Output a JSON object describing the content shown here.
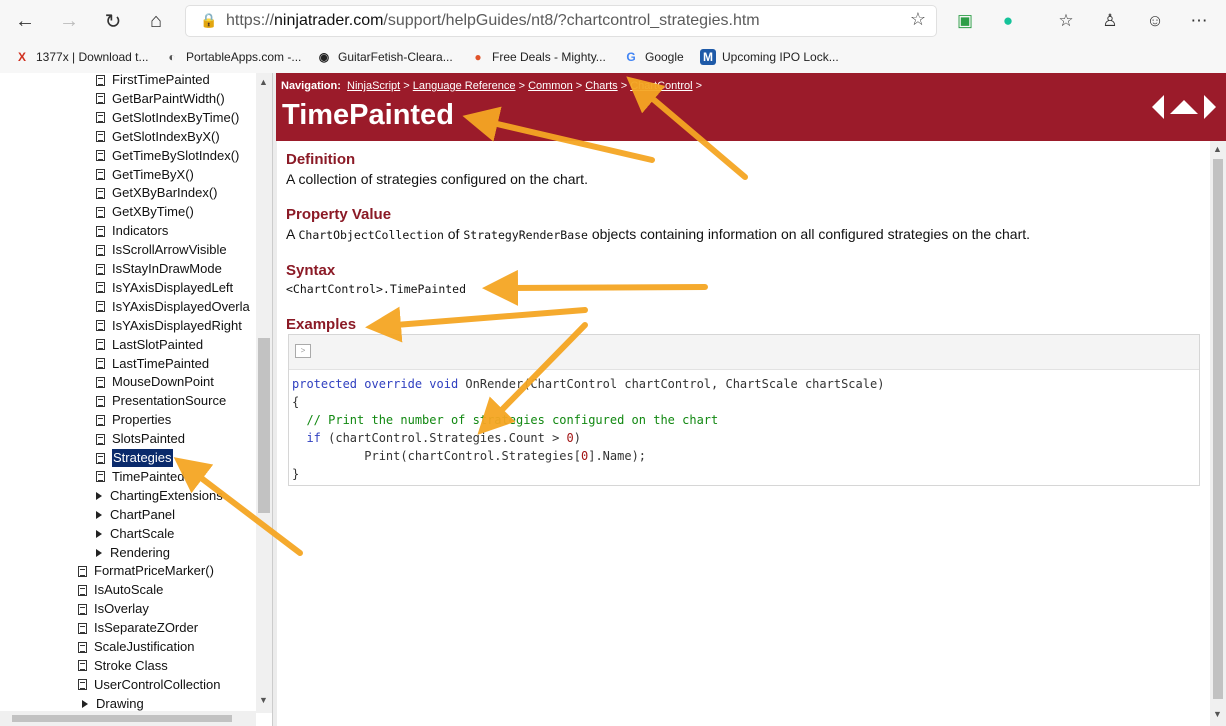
{
  "browser": {
    "url_prefix": "https://",
    "url_host": "ninjatrader.com",
    "url_path": "/support/helpGuides/nt8/?chartcontrol_strategies.htm"
  },
  "bookmarks": [
    {
      "label": "1377x | Download t...",
      "icon": "x-icon",
      "color": "#d0301f",
      "glyph": "X"
    },
    {
      "label": "PortableApps.com -...",
      "icon": "portableapps-icon",
      "color": "#555",
      "glyph": "◐"
    },
    {
      "label": "GuitarFetish-Cleara...",
      "icon": "guitarfetish-icon",
      "color": "#222",
      "glyph": "😎"
    },
    {
      "label": "Free Deals - Mighty...",
      "icon": "deals-icon",
      "color": "#e0532a",
      "glyph": "●"
    },
    {
      "label": "Google",
      "icon": "google-icon",
      "color": "#4285f4",
      "glyph": "G"
    },
    {
      "label": "Upcoming IPO Lock...",
      "icon": "ipo-icon",
      "color": "#1e5aa8",
      "glyph": "M"
    }
  ],
  "toc": [
    {
      "label": "FirstTimePainted",
      "type": "page",
      "indent": 2
    },
    {
      "label": "GetBarPaintWidth()",
      "type": "page",
      "indent": 2
    },
    {
      "label": "GetSlotIndexByTime()",
      "type": "page",
      "indent": 2
    },
    {
      "label": "GetSlotIndexByX()",
      "type": "page",
      "indent": 2
    },
    {
      "label": "GetTimeBySlotIndex()",
      "type": "page",
      "indent": 2
    },
    {
      "label": "GetTimeByX()",
      "type": "page",
      "indent": 2
    },
    {
      "label": "GetXByBarIndex()",
      "type": "page",
      "indent": 2
    },
    {
      "label": "GetXByTime()",
      "type": "page",
      "indent": 2
    },
    {
      "label": "Indicators",
      "type": "page",
      "indent": 2
    },
    {
      "label": "IsScrollArrowVisible",
      "type": "page",
      "indent": 2
    },
    {
      "label": "IsStayInDrawMode",
      "type": "page",
      "indent": 2
    },
    {
      "label": "IsYAxisDisplayedLeft",
      "type": "page",
      "indent": 2
    },
    {
      "label": "IsYAxisDisplayedOverla",
      "type": "page",
      "indent": 2
    },
    {
      "label": "IsYAxisDisplayedRight",
      "type": "page",
      "indent": 2
    },
    {
      "label": "LastSlotPainted",
      "type": "page",
      "indent": 2
    },
    {
      "label": "LastTimePainted",
      "type": "page",
      "indent": 2
    },
    {
      "label": "MouseDownPoint",
      "type": "page",
      "indent": 2
    },
    {
      "label": "PresentationSource",
      "type": "page",
      "indent": 2
    },
    {
      "label": "Properties",
      "type": "page",
      "indent": 2
    },
    {
      "label": "SlotsPainted",
      "type": "page",
      "indent": 2
    },
    {
      "label": "Strategies",
      "type": "page",
      "indent": 2,
      "selected": true
    },
    {
      "label": "TimePainted",
      "type": "page",
      "indent": 2
    },
    {
      "label": "ChartingExtensions",
      "type": "folder",
      "indent": 1
    },
    {
      "label": "ChartPanel",
      "type": "folder",
      "indent": 1
    },
    {
      "label": "ChartScale",
      "type": "folder",
      "indent": 1
    },
    {
      "label": "Rendering",
      "type": "folder",
      "indent": 1
    },
    {
      "label": "FormatPriceMarker()",
      "type": "page",
      "indent": 1
    },
    {
      "label": "IsAutoScale",
      "type": "page",
      "indent": 1
    },
    {
      "label": "IsOverlay",
      "type": "page",
      "indent": 1
    },
    {
      "label": "IsSeparateZOrder",
      "type": "page",
      "indent": 1
    },
    {
      "label": "ScaleJustification",
      "type": "page",
      "indent": 1
    },
    {
      "label": "Stroke Class",
      "type": "page",
      "indent": 1
    },
    {
      "label": "UserControlCollection",
      "type": "page",
      "indent": 1
    },
    {
      "label": "Drawing",
      "type": "folder",
      "indent": 0
    }
  ],
  "header": {
    "nav_label": "Navigation:",
    "crumbs": [
      "NinjaScript",
      "Language Reference",
      "Common",
      "Charts",
      "ChartControl"
    ],
    "separator": " > ",
    "title": "TimePainted",
    "color": "#9b1b2a"
  },
  "content": {
    "definition_title": "Definition",
    "definition_text": "A collection of strategies configured on the chart.",
    "property_title": "Property Value",
    "property_a": "A",
    "property_type1": "ChartObjectCollection",
    "property_of": "of",
    "property_type2": "StrategyRenderBase",
    "property_rest": "objects containing information on all configured strategies on the chart.",
    "syntax_title": "Syntax",
    "syntax_code": "<ChartControl>.TimePainted",
    "examples_title": "Examples"
  },
  "code": {
    "toolbar_button": ">",
    "l1_kw": "protected override void",
    "l1_rest": " OnRender(ChartControl chartControl, ChartScale chartScale)",
    "l2": "{",
    "l3_comment": "  // Print the number of strategies configured on the chart",
    "l4_kw": "  if",
    "l4_a": " (chartControl.Strategies.Count > ",
    "l4_num": "0",
    "l4_b": ")",
    "l5_a": "          Print(chartControl.Strategies[",
    "l5_num": "0",
    "l5_b": "].Name);",
    "l6": "}"
  },
  "annotation_color": "#f5a623"
}
